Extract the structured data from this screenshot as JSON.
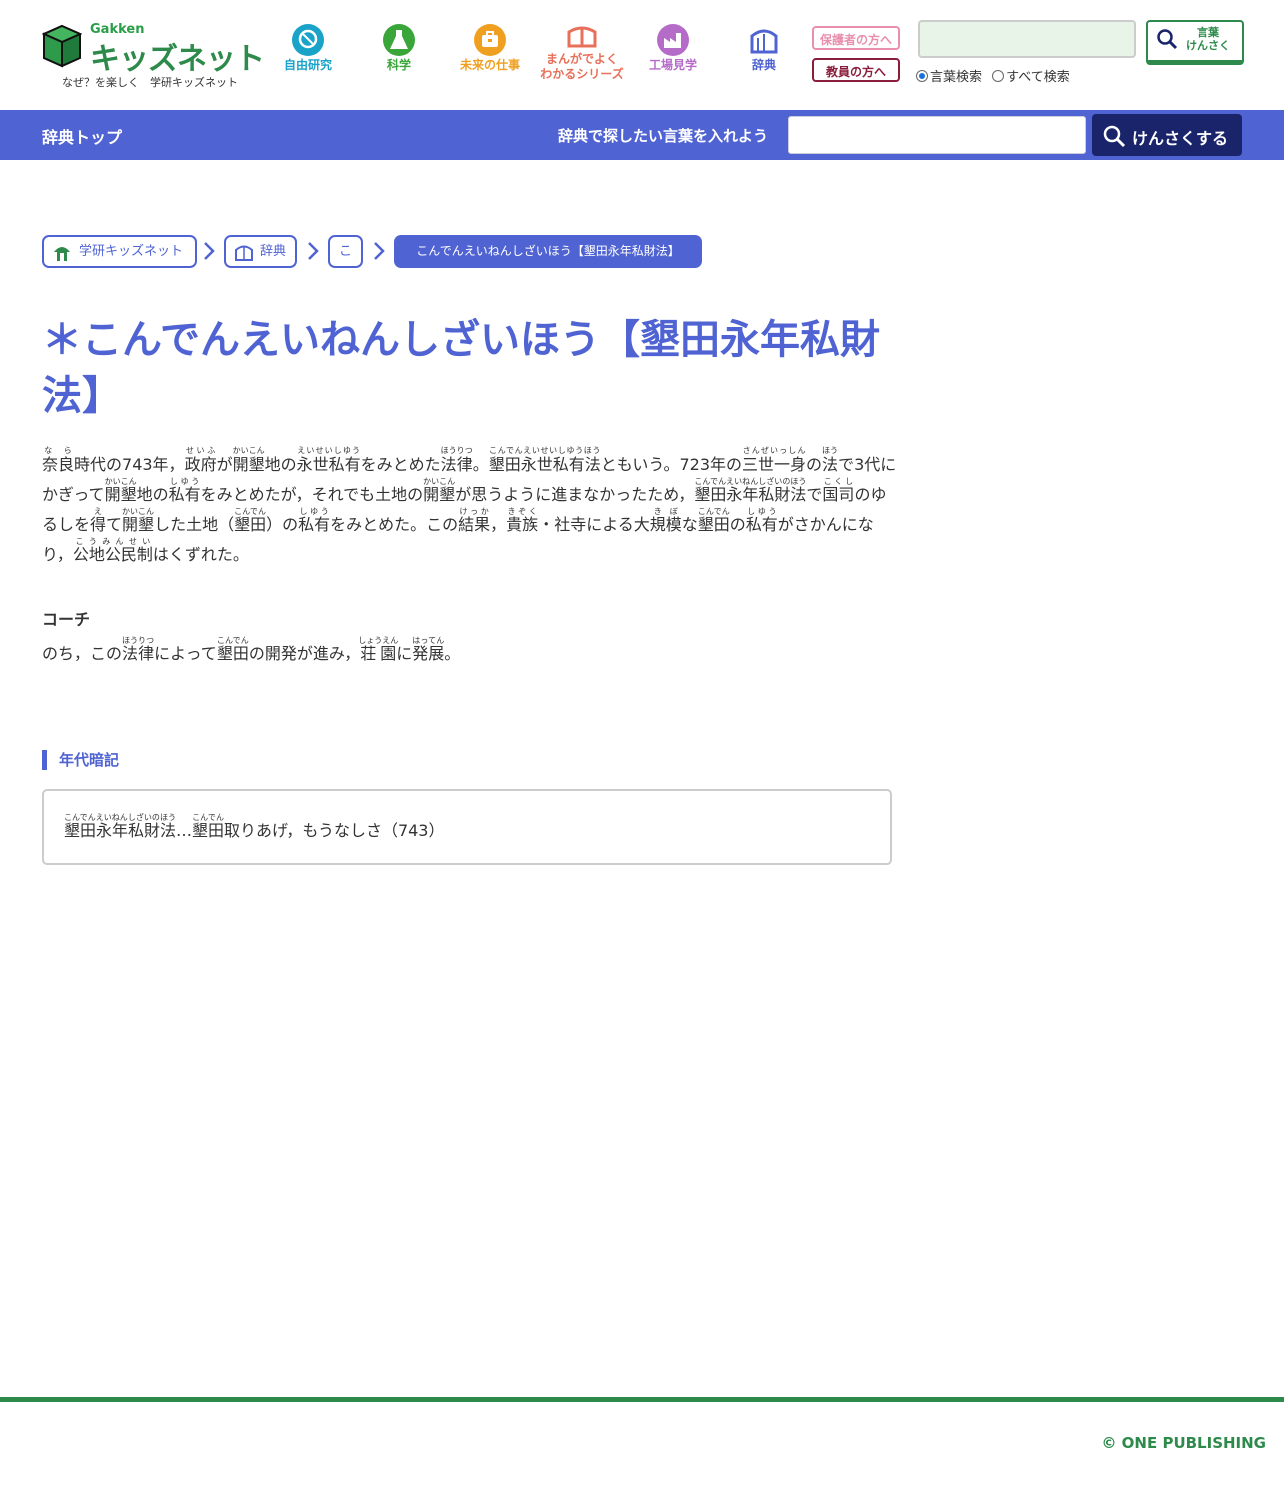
{
  "header": {
    "logo": {
      "brand": "Gakken",
      "name": "キッズネット",
      "tagline": "なぜ？を楽しく　学研キッズネット"
    },
    "nav": [
      {
        "label": "自由研究",
        "icon": "magnifier-research-icon",
        "color": "#1aa3c9"
      },
      {
        "label": "科学",
        "icon": "flask-icon",
        "color": "#3aa63a"
      },
      {
        "label": "未来の仕事",
        "icon": "briefcase-icon",
        "color": "#f0a020"
      },
      {
        "label": "まんがでよく\nわかるシリーズ",
        "icon": "manga-book-icon",
        "color": "#e8705a"
      },
      {
        "label": "工場見学",
        "icon": "factory-icon",
        "color": "#b56cc8"
      },
      {
        "label": "辞典",
        "icon": "dictionary-icon",
        "color": "#5063d3"
      }
    ],
    "parent_link": "保護者の方へ",
    "teacher_link": "教員の方へ",
    "search": {
      "placeholder": "",
      "button_label": "言葉\nけんさく"
    },
    "search_scope": {
      "options": [
        "言葉検索",
        "すべて検索"
      ],
      "selected": "言葉検索"
    }
  },
  "dict_bar": {
    "top_link": "辞典トップ",
    "prompt": "辞典で探したい言葉を入れよう",
    "input_placeholder": "",
    "button_label": "けんさくする"
  },
  "breadcrumb": [
    "学研キッズネット",
    "辞典",
    "こ",
    "こんでんえいねんしざいほう【墾田永年私財法】"
  ],
  "entry": {
    "title": "＊こんでんえいねんしざいほう【墾田永年私財法】",
    "body_html": "<ruby>奈良<rt>な ら</rt></ruby>時代の743年，<ruby>政府<rt>せいふ</rt></ruby>が<ruby>開墾<rt>かいこん</rt></ruby>地の<ruby>永世私有<rt>えいせいしゆう</rt></ruby>をみとめた<ruby>法律<rt>ほうりつ</rt></ruby>。<ruby>墾田永世私有法<rt>こんでんえいせいしゆうほう</rt></ruby>ともいう。723年の<ruby>三世一身<rt>さんぜいっしん</rt></ruby>の<ruby>法<rt>ほう</rt></ruby>で3代にかぎって<ruby>開墾<rt>かいこん</rt></ruby>地の<ruby>私有<rt>しゆう</rt></ruby>をみとめたが，それでも土地の<ruby>開墾<rt>かいこん</rt></ruby>が思うように進まなかったため，<ruby>墾田永年私財法<rt>こんでんえいねんしざいのほう</rt></ruby>で<ruby>国司<rt>こくし</rt></ruby>のゆるしを<ruby>得<rt>え</rt></ruby>て<ruby>開墾<rt>かいこん</rt></ruby>した土地（<ruby>墾田<rt>こんでん</rt></ruby>）の<ruby>私有<rt>しゆう</rt></ruby>をみとめた。この<ruby>結果<rt>けっか</rt></ruby>，<ruby>貴族<rt>きぞく</rt></ruby>・社寺による大<ruby>規模<rt>きぼ</rt></ruby>な<ruby>墾田<rt>こんでん</rt></ruby>の<ruby>私有<rt>しゆう</rt></ruby>がさかんになり，<ruby>公地公民制<rt>こうみんせい</rt></ruby>はくずれた。",
    "coach_heading": "コーチ",
    "coach_html": "のち，この<ruby>法律<rt>ほうりつ</rt></ruby>によって<ruby>墾田<rt>こんでん</rt></ruby>の開発が進み，<ruby>荘園<rt>しょうえん</rt></ruby>に<ruby>発展<rt>はってん</rt></ruby>。",
    "memo_heading": "年代暗記",
    "memo_html": "<ruby>墾田永年私財法<rt>こんでんえいねんしざいのほう</rt></ruby>…<ruby>墾田<rt>こんでん</rt></ruby>取りあげ，もうなしさ（743）"
  },
  "footer": {
    "copyright": "© ONE PUBLISHING"
  },
  "colors": {
    "accent": "#5063d3",
    "brand_green": "#2d8a4a",
    "navy": "#1a246b"
  }
}
